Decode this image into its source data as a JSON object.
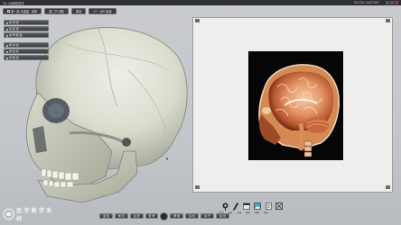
{
  "window": {
    "title": "3D 人体解剖软件",
    "right_title": "DIGITAL ANATOMY"
  },
  "breadcrumb": [
    {
      "label": "第一篇 头颈部 · 颅骨"
    },
    {
      "label": "第二节 颅腔"
    },
    {
      "label": "断层"
    },
    {
      "label": "CT · MRI 影像"
    }
  ],
  "side_menu": {
    "groups": [
      {
        "items": [
          {
            "label": "颅 骨 观"
          },
          {
            "label": "颅 底 观"
          },
          {
            "label": "颅 骨 断 面"
          }
        ]
      },
      {
        "items": [
          {
            "label": "颅 中 窝"
          },
          {
            "label": "颅 后 窝"
          },
          {
            "label": "颅 前 窝"
          }
        ]
      }
    ]
  },
  "image_panel": {
    "content": "sagittal-mri-slice"
  },
  "bottom_toolbar": {
    "left_buttons": [
      {
        "label": "返 回"
      },
      {
        "label": "前 页"
      },
      {
        "label": "后 页"
      },
      {
        "label": "目 录"
      }
    ],
    "right_buttons": [
      {
        "label": "帮 助"
      },
      {
        "label": "设 置"
      },
      {
        "label": "关 于"
      },
      {
        "label": "退 出"
      }
    ]
  },
  "tools": [
    {
      "icon": "locate-pin-icon",
      "label": "定位"
    },
    {
      "icon": "pen-icon",
      "label": "标注"
    },
    {
      "icon": "calendar-icon",
      "label": "记录"
    },
    {
      "icon": "picture-icon",
      "label": "图片"
    },
    {
      "icon": "document-icon",
      "label": "说明"
    },
    {
      "icon": "fullscreen-icon",
      "label": "全屏"
    }
  ],
  "logo": {
    "text": "医 学 教 学 系 统"
  },
  "colors": {
    "panel_bg": "#eeeeec",
    "toolbar_dark": "#3a3c40",
    "accent": "#b9583a"
  }
}
